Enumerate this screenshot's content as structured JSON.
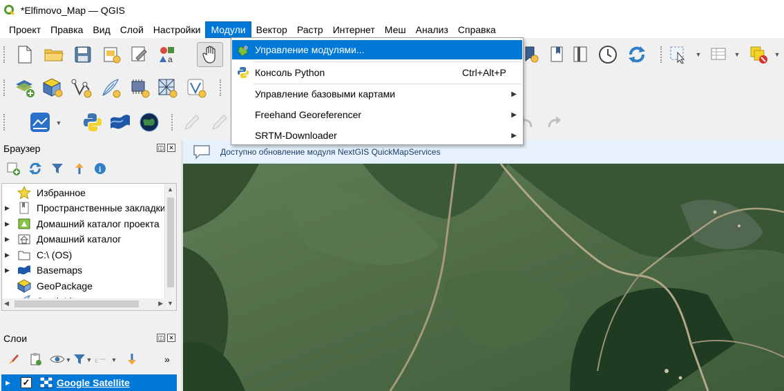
{
  "window": {
    "title": "*Elfimovo_Map — QGIS",
    "logo_icon": "qgis-logo-icon"
  },
  "menubar": {
    "items": [
      {
        "label": "Проект"
      },
      {
        "label": "Правка"
      },
      {
        "label": "Вид"
      },
      {
        "label": "Слой"
      },
      {
        "label": "Настройки"
      },
      {
        "label": "Модули",
        "active": true
      },
      {
        "label": "Вектор"
      },
      {
        "label": "Растр"
      },
      {
        "label": "Интернет"
      },
      {
        "label": "Меш"
      },
      {
        "label": "Анализ"
      },
      {
        "label": "Справка"
      }
    ]
  },
  "plugins_menu": {
    "items": [
      {
        "label": "Управление модулями...",
        "icon": "plugin-manager-icon",
        "highlighted": true
      },
      {
        "label": "Консоль Python",
        "icon": "python-console-icon",
        "shortcut": "Ctrl+Alt+P"
      },
      {
        "label": "Управление базовыми картами",
        "submenu": true
      },
      {
        "label": "Freehand Georeferencer",
        "submenu": true
      },
      {
        "label": "SRTM-Downloader",
        "submenu": true
      }
    ]
  },
  "message_bar": {
    "text": "Доступно обновление модуля NextGIS QuickMapServices",
    "icon": "message-bubble-icon"
  },
  "browser_panel": {
    "title": "Браузер",
    "items": [
      {
        "label": "Избранное",
        "icon": "star-icon",
        "expandable": false
      },
      {
        "label": "Пространственные закладки",
        "icon": "bookmark-icon",
        "expandable": true
      },
      {
        "label": "Домашний каталог проекта",
        "icon": "project-home-icon",
        "expandable": true
      },
      {
        "label": "Домашний каталог",
        "icon": "home-folder-icon",
        "expandable": true
      },
      {
        "label": "C:\\ (OS)",
        "icon": "drive-folder-icon",
        "expandable": true
      },
      {
        "label": "Basemaps",
        "icon": "basemaps-icon",
        "expandable": true
      },
      {
        "label": "GeoPackage",
        "icon": "geopackage-icon",
        "expandable": false
      },
      {
        "label": "SpatiaLite",
        "icon": "spatialite-feather-icon",
        "expandable": false
      }
    ]
  },
  "layers_panel": {
    "title": "Слои",
    "layers": [
      {
        "name": "Google Satellite",
        "checked": true,
        "icon": "xyz-tile-icon"
      }
    ]
  },
  "colors": {
    "accent": "#0078d7",
    "message_bar_bg": "#e6f1fb",
    "message_text": "#1b3f6b"
  }
}
